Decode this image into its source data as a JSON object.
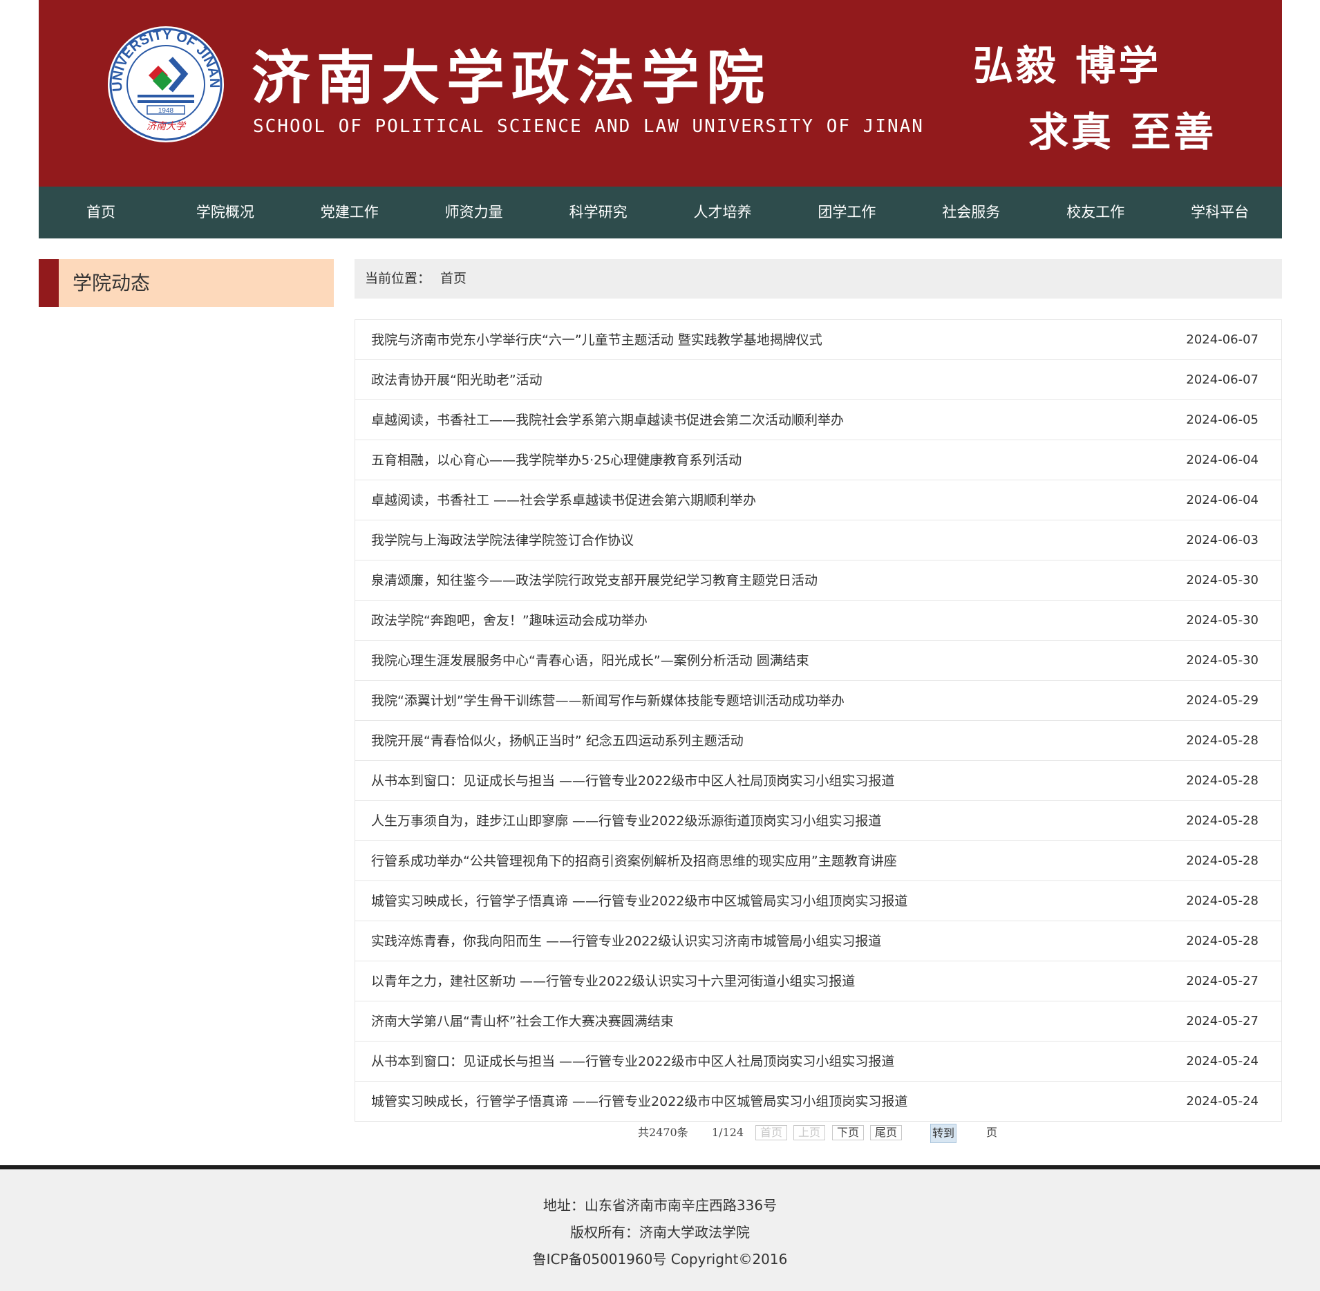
{
  "header": {
    "school_cn": "济南大学政法学院",
    "school_en": "SCHOOL OF POLITICAL SCIENCE AND LAW UNIVERSITY OF JINAN",
    "motto_line1": "弘毅 博学",
    "motto_line2": "求真 至善",
    "logo": {
      "ring_text": "UNIVERSITY OF JINAN",
      "year": "1948",
      "calligraphy": "济南大学",
      "icon": "university-seal"
    },
    "brand_color": "#921a1c"
  },
  "nav": {
    "items": [
      "首页",
      "学院概况",
      "党建工作",
      "师资力量",
      "科学研究",
      "人才培养",
      "团学工作",
      "社会服务",
      "校友工作",
      "学科平台"
    ],
    "background": "#2e4c4c"
  },
  "sidebar": {
    "title": "学院动态"
  },
  "breadcrumb": {
    "label": "当前位置：",
    "home": "首页"
  },
  "news": [
    {
      "title": "我院与济南市党东小学举行庆“六一”儿童节主题活动 暨实践教学基地揭牌仪式",
      "date": "2024-06-07"
    },
    {
      "title": "政法青协开展“阳光助老”活动",
      "date": "2024-06-07"
    },
    {
      "title": "卓越阅读，书香社工——我院社会学系第六期卓越读书促进会第二次活动顺利举办",
      "date": "2024-06-05"
    },
    {
      "title": "五育相融，以心育心——我学院举办5·25心理健康教育系列活动",
      "date": "2024-06-04"
    },
    {
      "title": "卓越阅读，书香社工 ——社会学系卓越读书促进会第六期顺利举办",
      "date": "2024-06-04"
    },
    {
      "title": "我学院与上海政法学院法律学院签订合作协议",
      "date": "2024-06-03"
    },
    {
      "title": "泉清颂廉，知往鉴今——政法学院行政党支部开展党纪学习教育主题党日活动",
      "date": "2024-05-30"
    },
    {
      "title": "政法学院“奔跑吧，舍友！”趣味运动会成功举办",
      "date": "2024-05-30"
    },
    {
      "title": "我院心理生涯发展服务中心“青春心语，阳光成长”—案例分析活动 圆满结束",
      "date": "2024-05-30"
    },
    {
      "title": "我院“添翼计划”学生骨干训练营——新闻写作与新媒体技能专题培训活动成功举办",
      "date": "2024-05-29"
    },
    {
      "title": "我院开展“青春恰似火，扬帆正当时” 纪念五四运动系列主题活动",
      "date": "2024-05-28"
    },
    {
      "title": "从书本到窗口：见证成长与担当 ——行管专业2022级市中区人社局顶岗实习小组实习报道",
      "date": "2024-05-28"
    },
    {
      "title": "人生万事须自为，跬步江山即寥廓 ——行管专业2022级泺源街道顶岗实习小组实习报道",
      "date": "2024-05-28"
    },
    {
      "title": "行管系成功举办“公共管理视角下的招商引资案例解析及招商思维的现实应用”主题教育讲座",
      "date": "2024-05-28"
    },
    {
      "title": "城管实习映成长，行管学子悟真谛 ——行管专业2022级市中区城管局实习小组顶岗实习报道",
      "date": "2024-05-28"
    },
    {
      "title": "实践淬炼青春，你我向阳而生 ——行管专业2022级认识实习济南市城管局小组实习报道",
      "date": "2024-05-28"
    },
    {
      "title": "以青年之力，建社区新功 ——行管专业2022级认识实习十六里河街道小组实习报道",
      "date": "2024-05-27"
    },
    {
      "title": "济南大学第八届“青山杯”社会工作大赛决赛圆满结束",
      "date": "2024-05-27"
    },
    {
      "title": "从书本到窗口：见证成长与担当 ——行管专业2022级市中区人社局顶岗实习小组实习报道",
      "date": "2024-05-24"
    },
    {
      "title": "城管实习映成长，行管学子悟真谛 ——行管专业2022级市中区城管局实习小组顶岗实习报道",
      "date": "2024-05-24"
    }
  ],
  "pagination": {
    "total": "共2470条",
    "page": "1/124",
    "first": "首页",
    "prev": "上页",
    "next": "下页",
    "last": "尾页",
    "goto": "转到",
    "page_unit": "页"
  },
  "footer": {
    "address": "地址：山东省济南市南辛庄西路336号",
    "copyright": "版权所有：济南大学政法学院",
    "icp": "鲁ICP备05001960号 Copyright©2016"
  }
}
